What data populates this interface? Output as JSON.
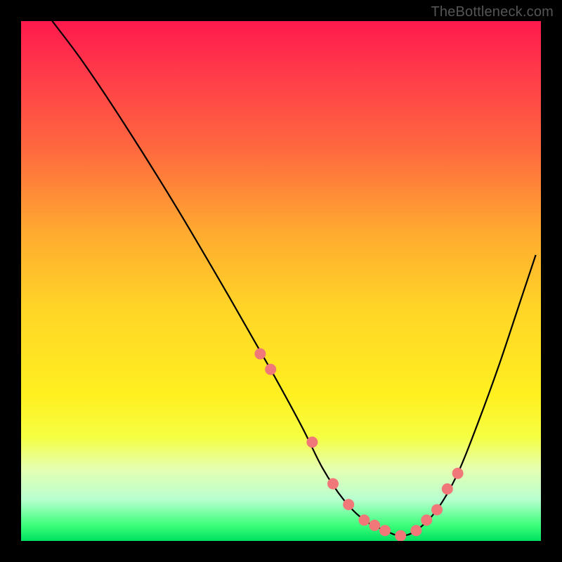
{
  "watermark": "TheBottleneck.com",
  "colors": {
    "gradient_top": "#ff1a4d",
    "gradient_bottom": "#00e060",
    "curve": "#000000",
    "dots": "#f07878",
    "background": "#000000"
  },
  "chart_data": {
    "type": "line",
    "title": "",
    "xlabel": "",
    "ylabel": "",
    "xlim": [
      0,
      100
    ],
    "ylim": [
      0,
      100
    ],
    "series": [
      {
        "name": "curve",
        "x": [
          6,
          12,
          20,
          30,
          40,
          48,
          54,
          58,
          62,
          66,
          70,
          73,
          76,
          80,
          84,
          88,
          92,
          96,
          99
        ],
        "values": [
          100,
          92,
          80,
          64,
          47,
          33,
          22,
          14,
          8,
          4,
          2,
          1,
          2,
          6,
          13,
          23,
          34,
          46,
          55
        ]
      }
    ],
    "points": {
      "name": "highlighted-dots",
      "x": [
        46,
        48,
        56,
        60,
        63,
        66,
        68,
        70,
        73,
        76,
        78,
        80,
        82,
        84
      ],
      "values": [
        36,
        33,
        19,
        11,
        7,
        4,
        3,
        2,
        1,
        2,
        4,
        6,
        10,
        13
      ]
    }
  }
}
